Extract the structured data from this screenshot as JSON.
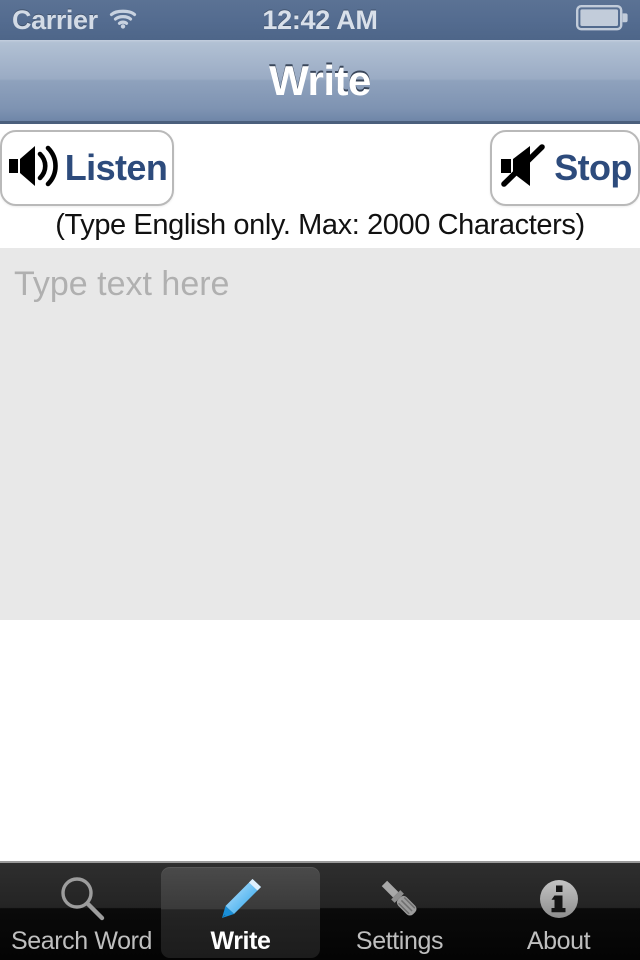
{
  "status_bar": {
    "carrier": "Carrier",
    "wifi_icon": "wifi-icon",
    "time": "12:42 AM",
    "battery_icon": "battery-icon"
  },
  "nav_bar": {
    "title": "Write"
  },
  "controls": {
    "listen": {
      "label": "Listen",
      "icon": "speaker-on-icon"
    },
    "stop": {
      "label": "Stop",
      "icon": "speaker-mute-icon"
    },
    "hint": "(Type English only. Max: 2000 Characters)"
  },
  "editor": {
    "placeholder": "Type text here",
    "value": ""
  },
  "tab_bar": {
    "items": [
      {
        "label": "Search Word",
        "icon": "magnifier-icon",
        "active": false
      },
      {
        "label": "Write",
        "icon": "pencil-icon",
        "active": true
      },
      {
        "label": "Settings",
        "icon": "screwdriver-icon",
        "active": false
      },
      {
        "label": "About",
        "icon": "info-circle-icon",
        "active": false
      }
    ]
  },
  "colors": {
    "nav_bar_top": "#c3cfdf",
    "nav_bar_bottom": "#6f86a8",
    "status_bar": "#546c90",
    "button_text": "#2d4b7c",
    "editor_background": "#e8e8e8",
    "placeholder": "#b0b0b0",
    "tab_bar_background": "#0a0a0a",
    "tab_active_label": "#ffffff",
    "tab_inactive_label": "#bfbfbf",
    "pencil_accent": "#4fb3f0"
  }
}
